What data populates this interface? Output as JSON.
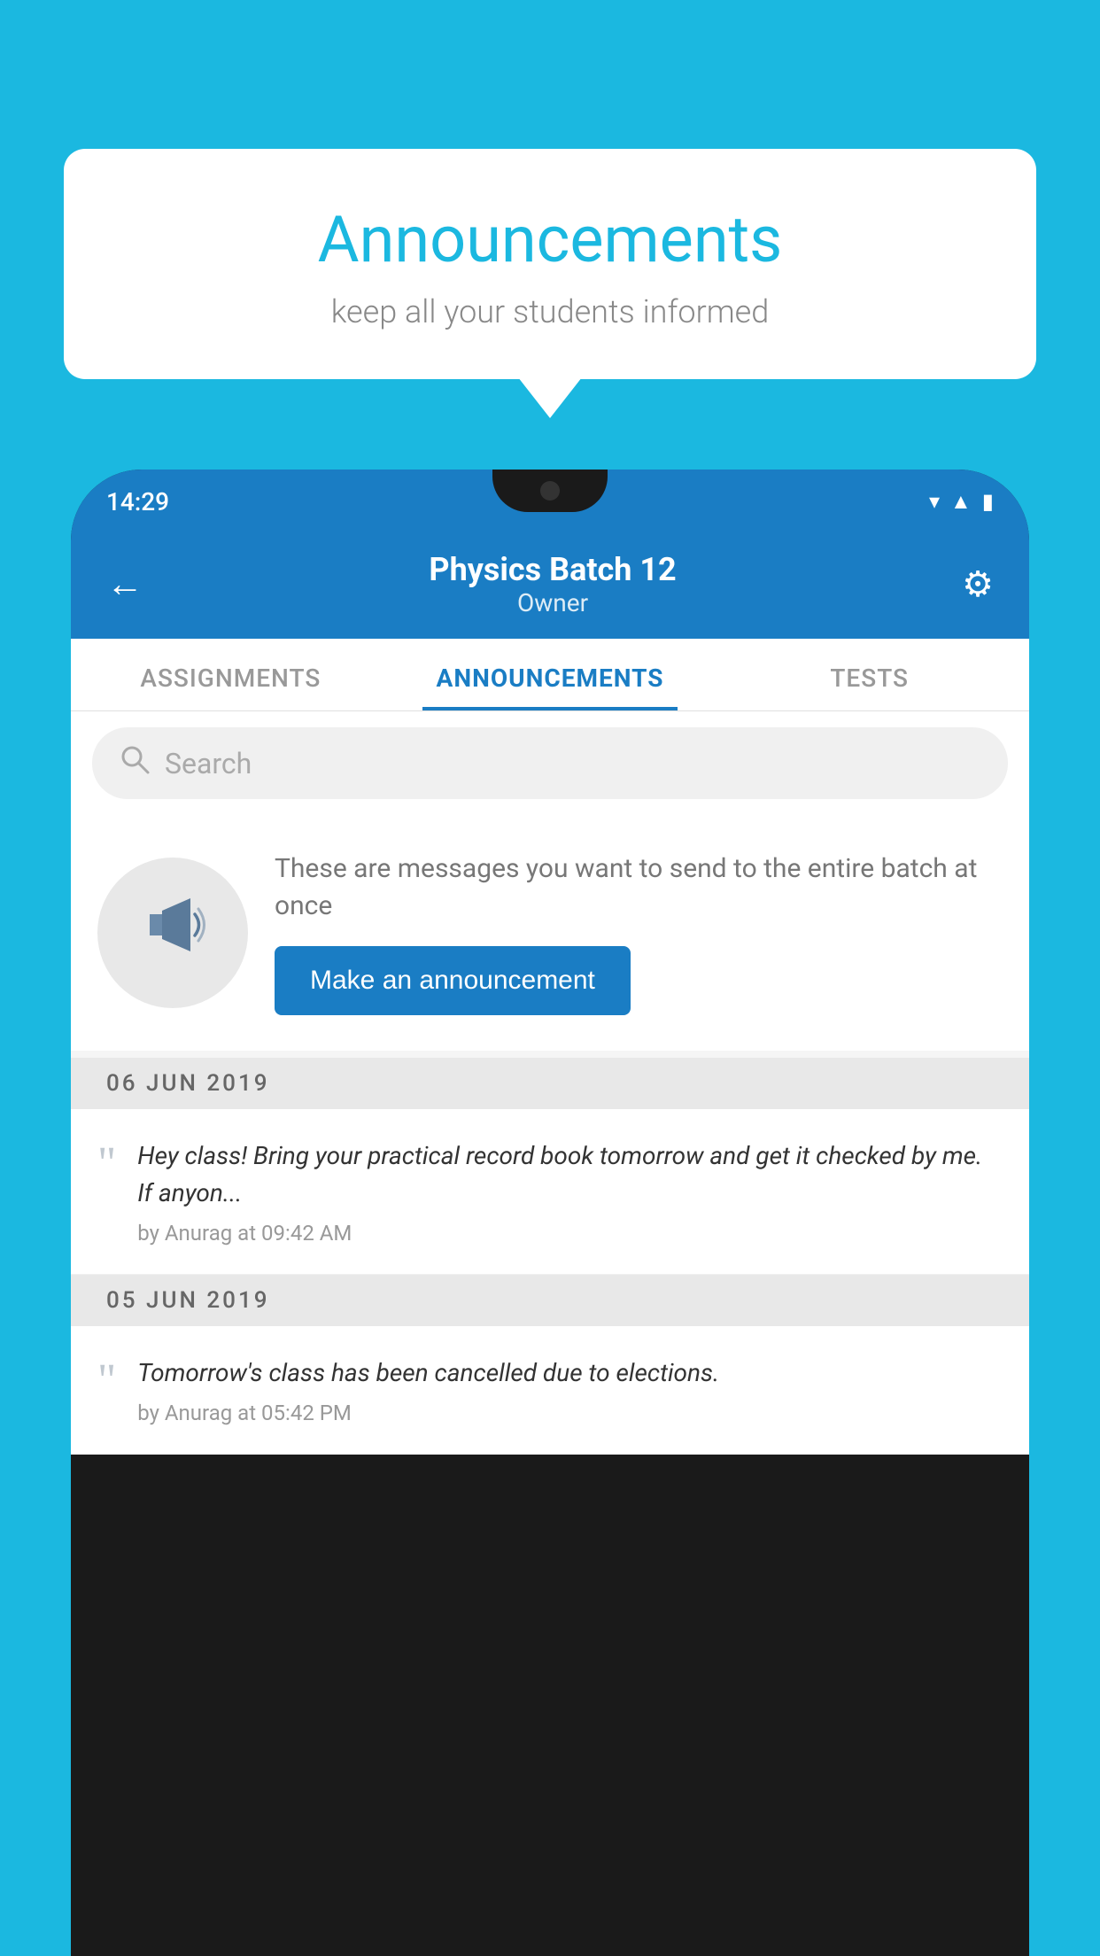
{
  "background_color": "#1BB8E0",
  "speech_bubble": {
    "title": "Announcements",
    "subtitle": "keep all your students informed"
  },
  "phone": {
    "status_bar": {
      "time": "14:29",
      "signal_icons": "▾◂▮"
    },
    "header": {
      "back_label": "←",
      "title": "Physics Batch 12",
      "subtitle": "Owner",
      "settings_icon": "⚙"
    },
    "tabs": [
      {
        "label": "ASSIGNMENTS",
        "active": false
      },
      {
        "label": "ANNOUNCEMENTS",
        "active": true
      },
      {
        "label": "TESTS",
        "active": false
      },
      {
        "label": "···",
        "active": false
      }
    ],
    "search": {
      "placeholder": "Search"
    },
    "announcement_promo": {
      "description": "These are messages you want to send to the entire batch at once",
      "button_label": "Make an announcement"
    },
    "announcements": [
      {
        "date": "06  JUN  2019",
        "message": "Hey class! Bring your practical record book tomorrow and get it checked by me. If anyon...",
        "meta": "by Anurag at 09:42 AM"
      },
      {
        "date": "05  JUN  2019",
        "message": "Tomorrow's class has been cancelled due to elections.",
        "meta": "by Anurag at 05:42 PM"
      }
    ]
  }
}
